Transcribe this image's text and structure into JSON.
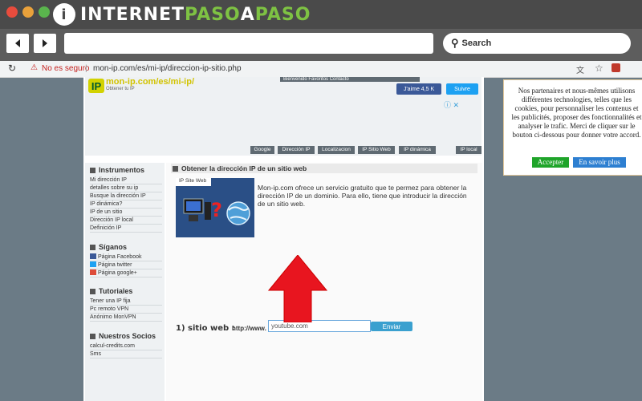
{
  "brand": {
    "prefix": "INTERNET",
    "mid": "PASO",
    "a": "A",
    "suffix": "PASO",
    "logo_letter": "i",
    "color_green": "#7ec243",
    "color_white": "#ffffff"
  },
  "browser": {
    "search_label": "Search",
    "security_label": "No es seguro",
    "url": "mon-ip.com/es/mi-ip/direccion-ip-sitio.php"
  },
  "site": {
    "link": "mon-ip.com/es/mi-ip/",
    "logo": "IP",
    "subtitle": "Obtener tu IP",
    "topline": "Bienvenido  Favoritos  Contacto",
    "fb_label": "J'aime 4,5 K",
    "tw_label": "Suivre",
    "tabs": [
      "Google",
      "Dirección IP",
      "Localizacion",
      "IP Sitio Web",
      "IP dinámica",
      "IP local"
    ]
  },
  "sidebar": {
    "instrumentos": {
      "title": "Instrumentos",
      "items": [
        "Mi dirección IP",
        "detalles sobre su ip",
        "Busque la dirección IP",
        "IP dinámica?",
        "IP de un sitio",
        "Dirección IP local",
        "Definición IP"
      ]
    },
    "siganos": {
      "title": "Síganos",
      "items": [
        "Página Facebook",
        "Página twitter",
        "Página google+"
      ]
    },
    "tutoriales": {
      "title": "Tutoriales",
      "items": [
        "Tener una IP fija",
        "Pc remoto VPN",
        "Anónimo MonVPN"
      ]
    },
    "socios": {
      "title": "Nuestros Socios",
      "items": [
        "calcul-credits.com",
        "Sms"
      ]
    }
  },
  "main": {
    "title": "Obtener la dirección IP de un sitio web",
    "image_label": "IP Site Web",
    "description": "Mon-ip.com ofrece un servicio gratuito que te permez para obtener la dirección IP de un dominio. Para ello, tiene que introducir la dirección de un sitio web.",
    "form_label": "1) sitio web :",
    "prefix": "http://www.",
    "input_value": "youtube.com",
    "submit_label": "Enviar"
  },
  "consent": {
    "text": "Nos partenaires et nous-mêmes utilisons différentes technologies, telles que les cookies, pour personnaliser les contenus et les publicités, proposer des fonctionnalités et analyser le trafic. Merci de cliquer sur le bouton ci-dessous pour donner votre accord.",
    "accept_label": "Accepter",
    "more_label": "En savoir plus",
    "accept_color": "#1fa42a",
    "more_color": "#2d7fd1"
  },
  "annotation": {
    "arrow_color": "#e8151f"
  }
}
